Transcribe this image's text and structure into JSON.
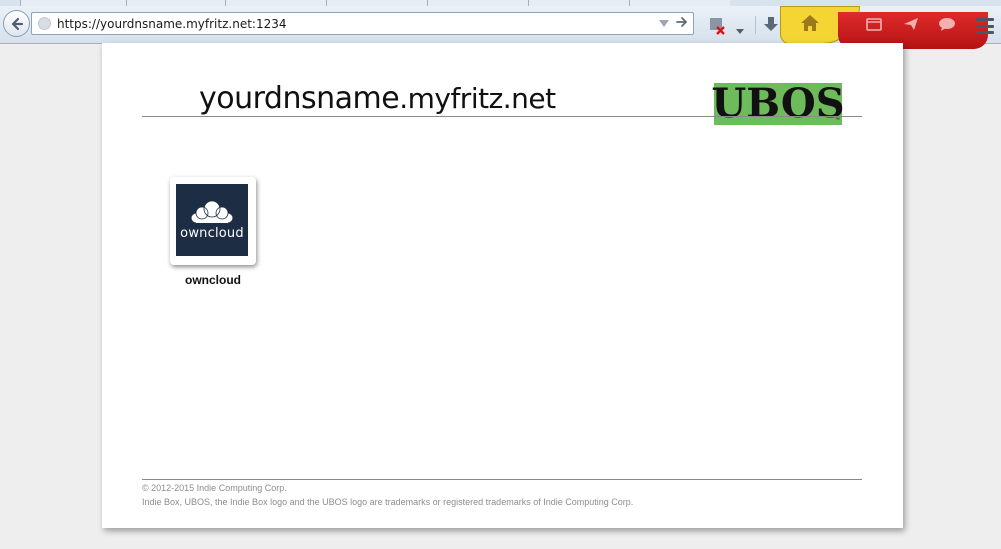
{
  "browser": {
    "url": "https://yourdnsname.myfritz.net:1234",
    "icons": {
      "back": "back-arrow-icon",
      "site": "globe-icon",
      "url_dropdown": "chevron-down-icon",
      "go": "go-arrow-icon",
      "addon": "addon-blocked-icon",
      "download": "download-icon",
      "home": "home-icon",
      "menu": "hamburger-menu-icon"
    }
  },
  "page": {
    "host_prefix": "yourdnsname",
    "host_suffix": ".myfritz.net",
    "logo_text": "UBOS",
    "logo_tm": "™",
    "logo_color": "#6dbb5b",
    "apps": [
      {
        "label": "owncloud",
        "icon_text": "owncloud",
        "icon_bg": "#1d2d44"
      }
    ],
    "footer": {
      "copyright": "© 2012-2015 Indie Computing Corp.",
      "trademark": "Indie Box, UBOS, the Indie Box logo and the UBOS logo are trademarks or registered trademarks of Indie Computing Corp."
    }
  }
}
